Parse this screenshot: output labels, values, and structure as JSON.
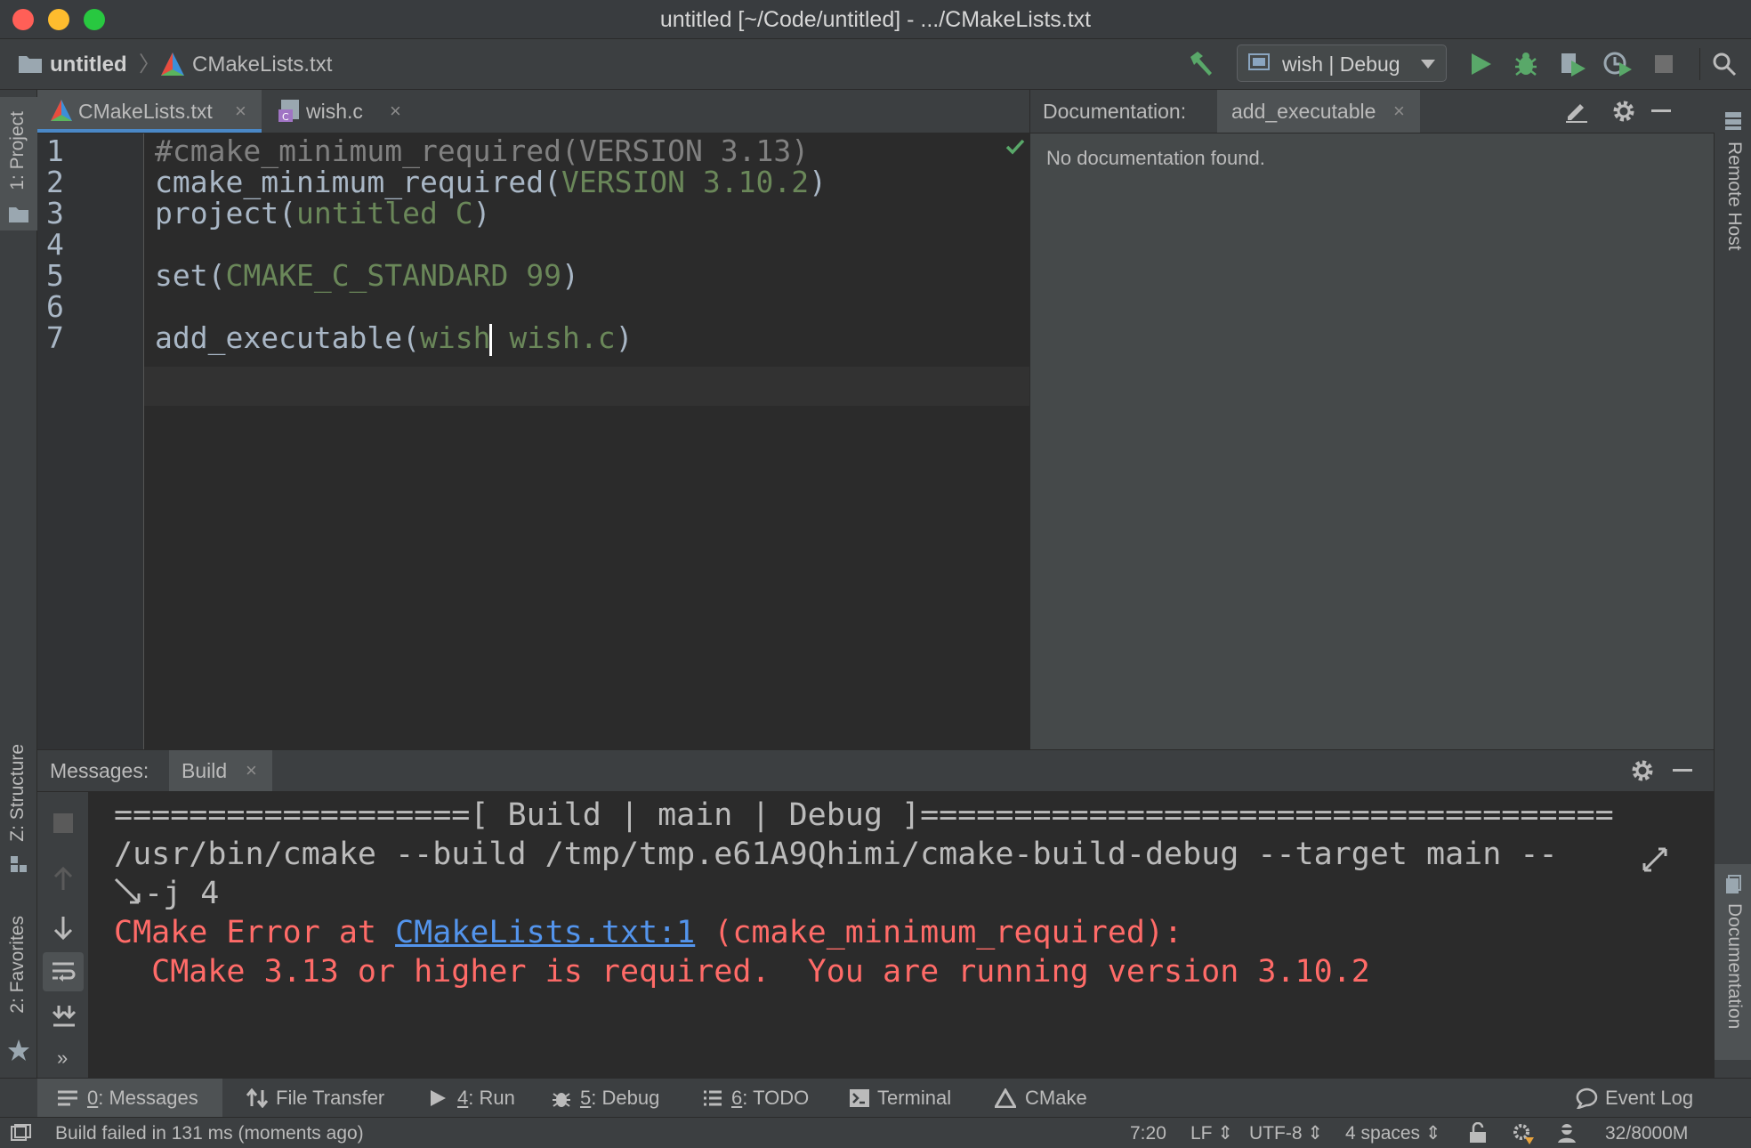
{
  "window": {
    "title": "untitled [~/Code/untitled] - .../CMakeLists.txt"
  },
  "navbar": {
    "project": "untitled",
    "separator": "〉",
    "file": "CMakeLists.txt",
    "run_config": "wish | Debug"
  },
  "left_strip": {
    "project": "1: Project",
    "structure": "Z: Structure",
    "favorites": "2: Favorites"
  },
  "right_strip": {
    "remote_host": "Remote Host",
    "documentation": "Documentation"
  },
  "tabs": [
    {
      "label": "CMakeLists.txt",
      "close": "×",
      "active": true
    },
    {
      "label": "wish.c",
      "close": "×",
      "active": false
    }
  ],
  "editor": {
    "line_numbers": [
      "1",
      "2",
      "3",
      "4",
      "5",
      "6",
      "7"
    ],
    "lines": [
      {
        "fn": "#cmake_minimum_required(VERSION 3.13)",
        "args": "",
        "close": ""
      },
      {
        "fn": "cmake_minimum_required(",
        "args": "VERSION 3.10.2",
        "close": ")"
      },
      {
        "fn": "project(",
        "args": "untitled C",
        "close": ")"
      },
      {
        "fn": "",
        "args": "",
        "close": ""
      },
      {
        "fn": "set(",
        "args": "CMAKE_C_STANDARD 99",
        "close": ")"
      },
      {
        "fn": "",
        "args": "",
        "close": ""
      },
      {
        "fn": "add_executable(",
        "args": "wish",
        "args2": " wish.c",
        "close": ")"
      }
    ]
  },
  "documentation": {
    "label": "Documentation:",
    "tab": "add_executable",
    "close": "×",
    "body": "No documentation found."
  },
  "messages": {
    "label": "Messages:",
    "tab": "Build",
    "close": "×",
    "console": [
      "===================[ Build | main | Debug ]=====================================",
      "/usr/bin/cmake --build /tmp/tmp.e61A9Qhimi/cmake-build-debug --target main --",
      "-j 4"
    ],
    "error_prefix": "CMake Error at ",
    "error_link": "CMakeLists.txt:1",
    "error_suffix": " (cmake_minimum_required):",
    "error_detail": "  CMake 3.13 or higher is required.  You are running version 3.10.2",
    "expand_glyph": "»"
  },
  "tool_windows": [
    {
      "key": "0",
      "label": ": Messages",
      "active": true
    },
    {
      "key": "",
      "label": "File Transfer"
    },
    {
      "key": "4",
      "label": ": Run"
    },
    {
      "key": "5",
      "label": ": Debug"
    },
    {
      "key": "6",
      "label": ": TODO"
    },
    {
      "key": "",
      "label": "Terminal"
    },
    {
      "key": "",
      "label": "CMake"
    },
    {
      "key": "",
      "label": "Event Log"
    }
  ],
  "status": {
    "message": "Build failed in 131 ms (moments ago)",
    "position": "7:20",
    "line_sep": "LF ⇕",
    "encoding": "UTF-8 ⇕",
    "indent": "4 spaces ⇕",
    "memory": "32/8000M"
  },
  "colors": {
    "close_red": "#ff5f57",
    "minimize_yellow": "#febc2e",
    "zoom_green": "#28c840",
    "run_green": "#59a869",
    "error_red": "#ff6b68",
    "link_blue": "#5394ec"
  }
}
